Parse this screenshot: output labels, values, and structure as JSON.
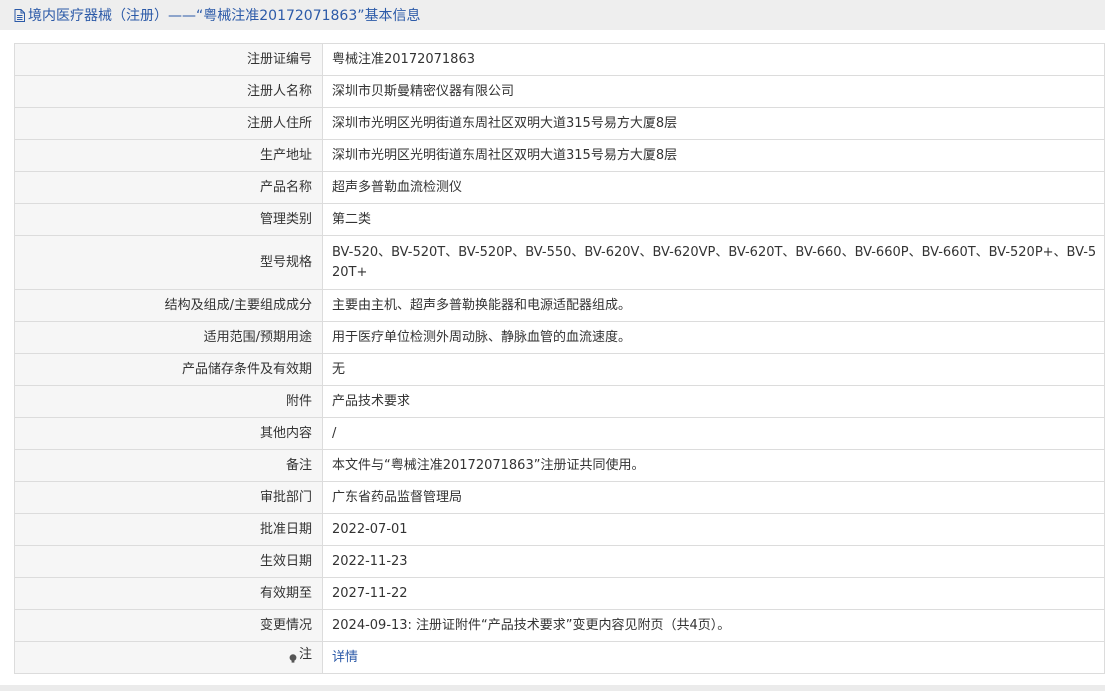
{
  "header": {
    "title": "境内医疗器械（注册）——“粤械注准20172071863”基本信息"
  },
  "rows": [
    {
      "label": "注册证编号",
      "value": "粤械注准20172071863"
    },
    {
      "label": "注册人名称",
      "value": "深圳市贝斯曼精密仪器有限公司"
    },
    {
      "label": "注册人住所",
      "value": "深圳市光明区光明街道东周社区双明大道315号易方大厦8层"
    },
    {
      "label": "生产地址",
      "value": "深圳市光明区光明街道东周社区双明大道315号易方大厦8层"
    },
    {
      "label": "产品名称",
      "value": "超声多普勒血流检测仪"
    },
    {
      "label": "管理类别",
      "value": "第二类"
    },
    {
      "label": "型号规格",
      "value": "BV-520、BV-520T、BV-520P、BV-550、BV-620V、BV-620VP、BV-620T、BV-660、BV-660P、BV-660T、BV-520P+、BV-520T+"
    },
    {
      "label": "结构及组成/主要组成成分",
      "value": "主要由主机、超声多普勒换能器和电源适配器组成。"
    },
    {
      "label": "适用范围/预期用途",
      "value": "用于医疗单位检测外周动脉、静脉血管的血流速度。"
    },
    {
      "label": "产品储存条件及有效期",
      "value": "无"
    },
    {
      "label": "附件",
      "value": "产品技术要求"
    },
    {
      "label": "其他内容",
      "value": "/"
    },
    {
      "label": "备注",
      "value": "本文件与“粤械注准20172071863”注册证共同使用。"
    },
    {
      "label": "审批部门",
      "value": "广东省药品监督管理局"
    },
    {
      "label": "批准日期",
      "value": "2022-07-01"
    },
    {
      "label": "生效日期",
      "value": "2022-11-23"
    },
    {
      "label": "有效期至",
      "value": "2027-11-22"
    },
    {
      "label": "变更情况",
      "value": "2024-09-13: 注册证附件“产品技术要求”变更内容见附页（共4页）。"
    }
  ],
  "note": {
    "label": "注",
    "link_text": "详情",
    "icon": "lightbulb-icon"
  },
  "colors": {
    "title": "#2c5aa8",
    "link": "#2c5aa8",
    "label_bg": "#f6f6f6",
    "border": "#dcdcdc"
  }
}
